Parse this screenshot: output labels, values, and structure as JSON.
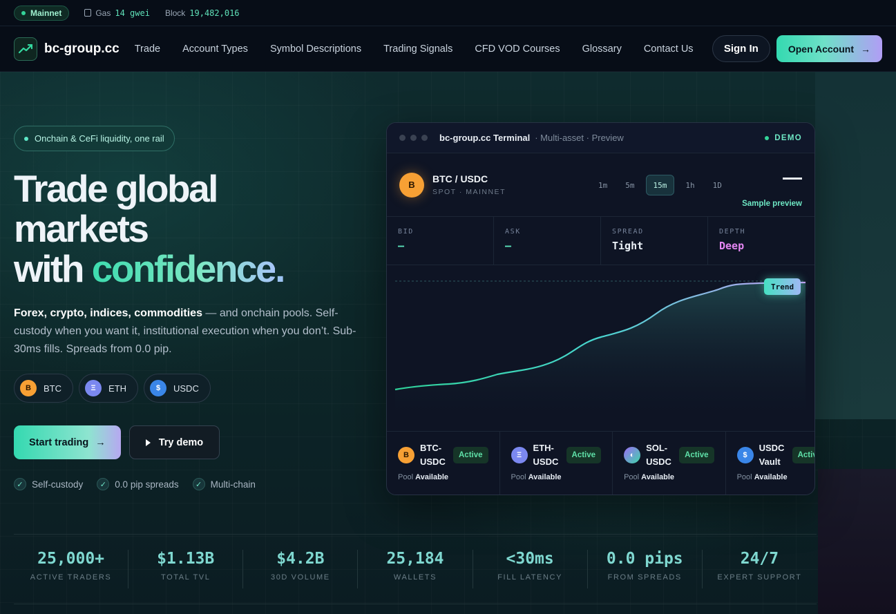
{
  "status": {
    "network": "Mainnet",
    "gas_label": "Gas",
    "gas_value": "14 gwei",
    "block_label": "Block",
    "block_value": "19,482,016"
  },
  "nav": {
    "logo_text": "bc-group.cc",
    "links": [
      "Trade",
      "Account Types",
      "Symbol Descriptions",
      "Trading Signals",
      "CFD VOD Courses",
      "Glossary",
      "Contact Us"
    ],
    "sign_in": "Sign In",
    "open_account": "Open Account"
  },
  "hero": {
    "eyebrow": "Onchain & CeFi liquidity, one rail",
    "headline_line1": "Trade global",
    "headline_line2": "markets",
    "headline_with": "with ",
    "headline_accent": "confidence",
    "headline_period": ".",
    "lead_bold": "Forex, crypto, indices, commodities",
    "lead_rest": " — and onchain pools. Self-custody when you want it, institutional execution when you don’t. Sub-30ms fills. Spreads from 0.0 pip.",
    "chips": [
      {
        "symbol": "B",
        "label": "BTC"
      },
      {
        "symbol": "Ξ",
        "label": "ETH"
      },
      {
        "symbol": "$",
        "label": "USDC"
      }
    ],
    "start_trading": "Start trading",
    "try_demo": "Try demo",
    "checks": [
      "Self-custody",
      "0.0 pip spreads",
      "Multi-chain"
    ]
  },
  "terminal": {
    "title": "bc-group.cc Terminal",
    "subtitle": "· Multi-asset · Preview",
    "demo": "DEMO",
    "pair": "BTC / USDC",
    "pair_sub": "SPOT · MAINNET",
    "pair_symbol": "B",
    "timeframes": [
      "1m",
      "5m",
      "15m",
      "1h",
      "1D"
    ],
    "active_timeframe": "15m",
    "sample": "Sample preview",
    "quotes": [
      {
        "label": "BID",
        "value": "—"
      },
      {
        "label": "ASK",
        "value": "—"
      },
      {
        "label": "SPREAD",
        "value": "Tight"
      },
      {
        "label": "DEPTH",
        "value": "Deep"
      }
    ],
    "trend_tag": "Trend",
    "pools": [
      {
        "symbol": "B",
        "name": "BTC-USDC",
        "status": "Active",
        "avail_label": "Pool",
        "avail_value": "Available"
      },
      {
        "symbol": "Ξ",
        "name": "ETH-USDC",
        "status": "Active",
        "avail_label": "Pool",
        "avail_value": "Available"
      },
      {
        "symbol": "◐",
        "name": "SOL-USDC",
        "status": "Active",
        "avail_label": "Pool",
        "avail_value": "Available"
      },
      {
        "symbol": "$",
        "name": "USDC Vault",
        "status": "Active",
        "avail_label": "Pool",
        "avail_value": "Available"
      }
    ]
  },
  "stats": [
    {
      "value": "25,000+",
      "label": "ACTIVE TRADERS"
    },
    {
      "value": "$1.13B",
      "label": "TOTAL TVL"
    },
    {
      "value": "$4.2B",
      "label": "30D VOLUME"
    },
    {
      "value": "25,184",
      "label": "WALLETS"
    },
    {
      "value": "<30ms",
      "label": "FILL LATENCY"
    },
    {
      "value": "0.0 pips",
      "label": "FROM SPREADS"
    },
    {
      "value": "24/7",
      "label": "EXPERT SUPPORT"
    }
  ],
  "colors": {
    "accent_teal": "#34d9b0",
    "accent_violet": "#b19df5",
    "bitcoin": "#f7a034",
    "active_green": "#5fe0a8",
    "depth_pink": "#e486f2"
  }
}
